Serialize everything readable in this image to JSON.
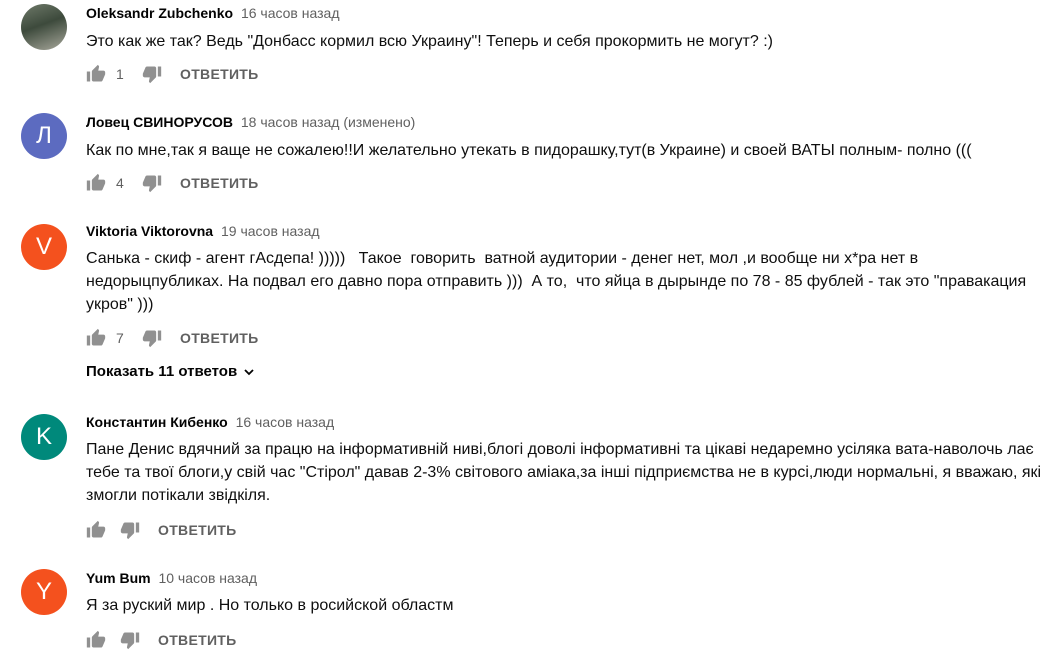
{
  "colors": {
    "avatar_l": "#5c6bc0",
    "avatar_v": "#f4511e",
    "avatar_k": "#00897b",
    "avatar_y": "#f4511e"
  },
  "comments": [
    {
      "author": "Oleksandr Zubchenko",
      "time": "16 часов назад",
      "text": "Это как же так? Ведь \"Донбасс кормил всю Украину\"! Теперь и себя прокормить не могут? :)",
      "likes": "1",
      "reply_label": "ОТВЕТИТЬ"
    },
    {
      "author": "Ловец СВИНОРУСОВ",
      "avatar_letter": "Л",
      "time": "18 часов назад (изменено)",
      "text": "Как по мне,так я ваще не сожалею!!И желательно утекать в пидорашку,тут(в Украине) и своей ВАТЫ полным- полно (((",
      "likes": "4",
      "reply_label": "ОТВЕТИТЬ"
    },
    {
      "author": "Viktoria Viktorovna",
      "avatar_letter": "V",
      "time": "19 часов назад",
      "text": "Санька - скиф - агент гАсдепа! )))))   Такое  говорить  ватной аудитории - денег нет, мол ,и вообще ни х*ра нет в недорыцпубликах. На подвал его давно пора отправить )))  А то,  что яйца в дырынде по 78 - 85 фублей - так это \"правакация укров\" )))",
      "likes": "7",
      "reply_label": "ОТВЕТИТЬ",
      "show_replies": "Показать 11 ответов"
    },
    {
      "author": "Константин Кибенко",
      "avatar_letter": "K",
      "time": "16 часов назад",
      "text": "Пане Денис вдячний за працю на інформативній ниві,блогі доволі інформативні та цікаві недаремно усіляка вата-наволочь лає тебе та твої блоги,у свій час \"Стірол\" давав 2-3% світового аміака,за інші підприємства не в курсі,люди нормальні, я вважаю, які змогли потікали звідкіля.",
      "likes": "",
      "reply_label": "ОТВЕТИТЬ"
    },
    {
      "author": "Yum Bum",
      "avatar_letter": "Y",
      "time": "10 часов назад",
      "text": "Я за руский мир . Но только в росийской областм",
      "likes": "",
      "reply_label": "ОТВЕТИТЬ"
    }
  ]
}
